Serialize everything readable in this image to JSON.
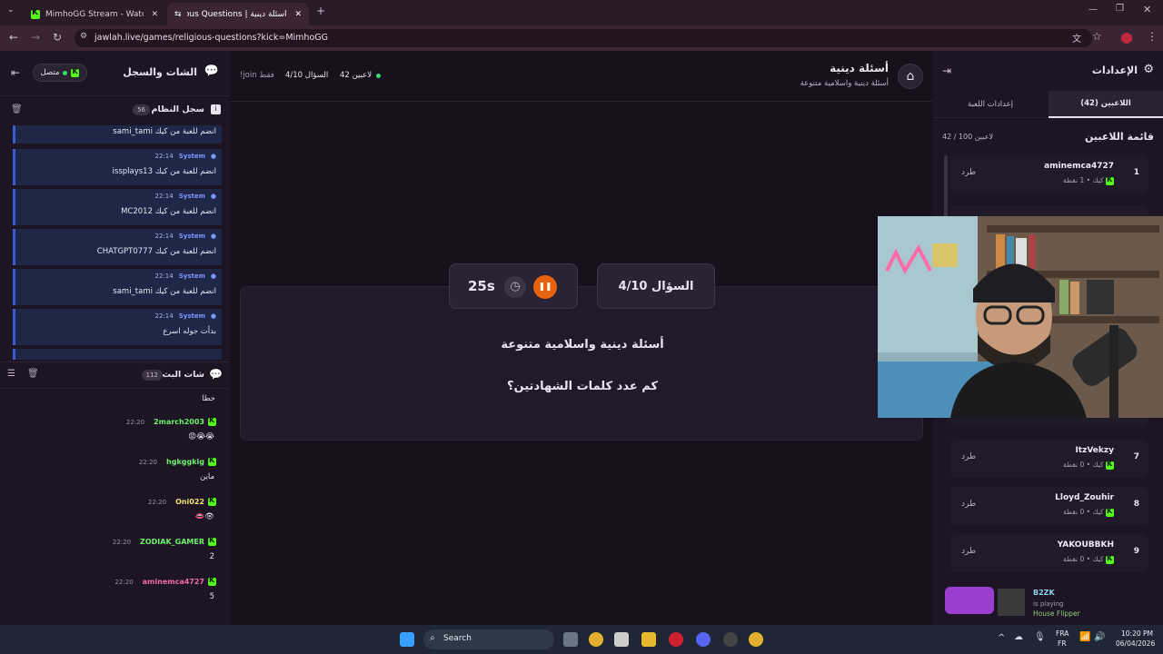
{
  "browser": {
    "tabs": [
      {
        "title": "MimhoGG Stream - Watch Live"
      },
      {
        "title": "أسئلة دينية | Religious Questions"
      }
    ],
    "url": "jawlah.live/games/religious-questions?kick=MimhoGG"
  },
  "left": {
    "chat_log_title": "الشات والسجل",
    "status": "متصل",
    "system_log": {
      "title": "سجل النظام",
      "count": "56",
      "items": [
        {
          "user": "System",
          "time": "22:14",
          "msg": "sami_tami انضم للعبة من كيك"
        },
        {
          "user": "System",
          "time": "22:14",
          "msg": "issplays13 انضم للعبة من كيك"
        },
        {
          "user": "System",
          "time": "22:14",
          "msg": "MC2012 انضم للعبة من كيك"
        },
        {
          "user": "System",
          "time": "22:14",
          "msg": "CHATGPT0777 انضم للعبة من كيك"
        },
        {
          "user": "System",
          "time": "22:14",
          "msg": "sami_tami انضم للعبة من كيك"
        },
        {
          "user": "System",
          "time": "22:14",
          "msg": "بدأت جوله اسرع"
        }
      ]
    },
    "stream_chat": {
      "title": "شات البث",
      "count": "112",
      "top_text": "خطا",
      "messages": [
        {
          "user": "2march2003",
          "time": "22:20",
          "text": "😡😭😭",
          "color": "#6cf06c"
        },
        {
          "user": "hgkggkig",
          "time": "22:20",
          "text": "ماين",
          "color": "#6cf06c"
        },
        {
          "user": "Oni022",
          "time": "22:20",
          "text": "👄👁",
          "color": "#f0e06c"
        },
        {
          "user": "ZODIAK_GAMER",
          "time": "22:20",
          "text": "2",
          "color": "#6cf06c"
        },
        {
          "user": "aminemca4727",
          "time": "22:20",
          "text": "5",
          "color": "#f06ca8"
        }
      ]
    }
  },
  "header": {
    "title": "أسئلة دينية",
    "subtitle": "أسئلة دينية واسلامية متنوعة",
    "players": "42 لاعبين",
    "question": "السؤال 4/10",
    "join_note": "!join فقط"
  },
  "game": {
    "question_label": "السؤال 4/10",
    "timer": "25s",
    "category": "أسئلة دينية واسلامية متنوعة",
    "question": "كم عدد كلمات الشهادتين؟"
  },
  "right": {
    "settings_title": "الإعدادات",
    "tabs": [
      {
        "label": "اللاعبين (42)"
      },
      {
        "label": "إعدادات اللعبة"
      }
    ],
    "list_title": "قائمة اللاعبين",
    "list_count": "42 / 100 لاعبين",
    "kick_label": "طرد",
    "players": [
      {
        "num": "1",
        "name": "aminemca4727",
        "sub": "كيك • 1 نقطة"
      },
      {
        "num": "7",
        "name": "ItzVekzy",
        "sub": "كيك • 0 نقطة"
      },
      {
        "num": "8",
        "name": "Lloyd_Zouhir",
        "sub": "كيك • 0 نقطة"
      },
      {
        "num": "9",
        "name": "YAKOUBBKH",
        "sub": "كيك • 0 نقطة"
      }
    ]
  },
  "notification": {
    "name": "B2ZK",
    "line1": "is playing",
    "line2": "House Flipper"
  },
  "taskbar": {
    "search": "Search",
    "lang1": "FRA",
    "lang2": "FR",
    "time": "10:20 PM",
    "date": "06/04/2026"
  }
}
